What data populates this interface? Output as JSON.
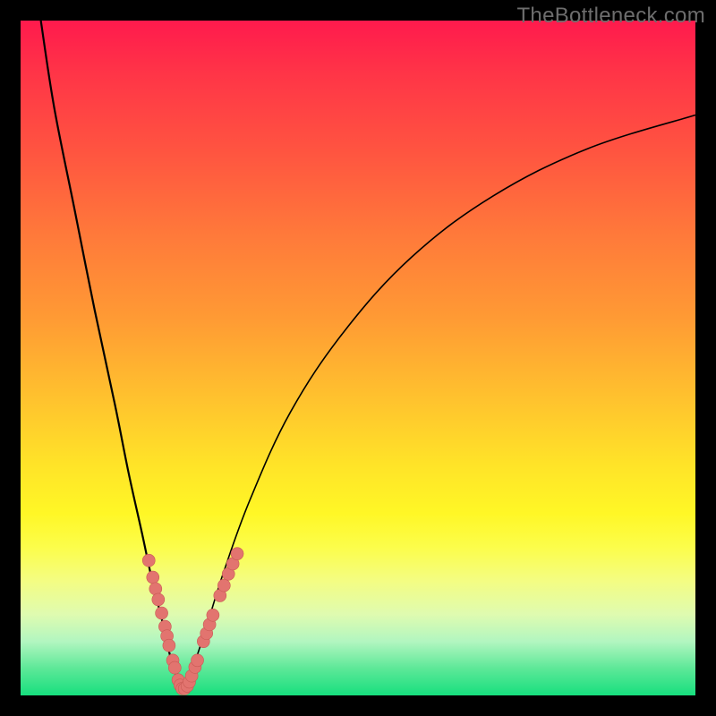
{
  "watermark": "TheBottleneck.com",
  "colors": {
    "background": "#000000",
    "curve_stroke": "#000000",
    "marker_fill": "#e2746f",
    "marker_stroke": "#c95a55"
  },
  "chart_data": {
    "type": "line",
    "title": "",
    "xlabel": "",
    "ylabel": "",
    "x_range": [
      0,
      100
    ],
    "y_range": [
      0,
      100
    ],
    "note": "No axis ticks or numeric labels are visible; values are normalized 0–100 estimates from pixel geometry.",
    "series": [
      {
        "name": "left-curve",
        "x": [
          3,
          5,
          8,
          11,
          14,
          16,
          18,
          19.5,
          21,
          22,
          23,
          23.8
        ],
        "y": [
          100,
          87,
          72,
          57,
          43,
          33,
          24,
          17,
          11,
          6.5,
          3,
          0.8
        ]
      },
      {
        "name": "right-curve",
        "x": [
          24.2,
          25.5,
          27.5,
          30,
          34,
          40,
          48,
          58,
          70,
          84,
          100
        ],
        "y": [
          0.8,
          4,
          10,
          18,
          29,
          42,
          54,
          65,
          74,
          81,
          86
        ]
      }
    ],
    "markers": [
      {
        "group": "left-upper",
        "x": 19.0,
        "y": 20.0
      },
      {
        "group": "left-upper",
        "x": 19.6,
        "y": 17.5
      },
      {
        "group": "left-upper",
        "x": 20.0,
        "y": 15.8
      },
      {
        "group": "left-upper",
        "x": 20.4,
        "y": 14.2
      },
      {
        "group": "left-upper",
        "x": 20.9,
        "y": 12.2
      },
      {
        "group": "left-mid",
        "x": 21.4,
        "y": 10.2
      },
      {
        "group": "left-mid",
        "x": 21.7,
        "y": 8.8
      },
      {
        "group": "left-mid",
        "x": 22.0,
        "y": 7.4
      },
      {
        "group": "left-low",
        "x": 22.55,
        "y": 5.2
      },
      {
        "group": "left-low",
        "x": 22.85,
        "y": 4.1
      },
      {
        "group": "bottom",
        "x": 23.35,
        "y": 2.3
      },
      {
        "group": "bottom",
        "x": 23.65,
        "y": 1.5
      },
      {
        "group": "bottom",
        "x": 23.95,
        "y": 1.0
      },
      {
        "group": "bottom",
        "x": 24.3,
        "y": 1.0
      },
      {
        "group": "bottom",
        "x": 24.7,
        "y": 1.4
      },
      {
        "group": "bottom",
        "x": 25.0,
        "y": 2.0
      },
      {
        "group": "bottom",
        "x": 25.35,
        "y": 2.9
      },
      {
        "group": "right-low",
        "x": 25.85,
        "y": 4.2
      },
      {
        "group": "right-low",
        "x": 26.2,
        "y": 5.2
      },
      {
        "group": "right-mid",
        "x": 27.1,
        "y": 8.0
      },
      {
        "group": "right-mid",
        "x": 27.55,
        "y": 9.2
      },
      {
        "group": "right-mid",
        "x": 28.0,
        "y": 10.5
      },
      {
        "group": "right-mid",
        "x": 28.5,
        "y": 11.9
      },
      {
        "group": "right-upper",
        "x": 29.55,
        "y": 14.8
      },
      {
        "group": "right-upper",
        "x": 30.15,
        "y": 16.3
      },
      {
        "group": "right-upper",
        "x": 30.8,
        "y": 18.0
      },
      {
        "group": "right-upper",
        "x": 31.45,
        "y": 19.5
      },
      {
        "group": "right-upper",
        "x": 32.1,
        "y": 21.0
      }
    ]
  }
}
